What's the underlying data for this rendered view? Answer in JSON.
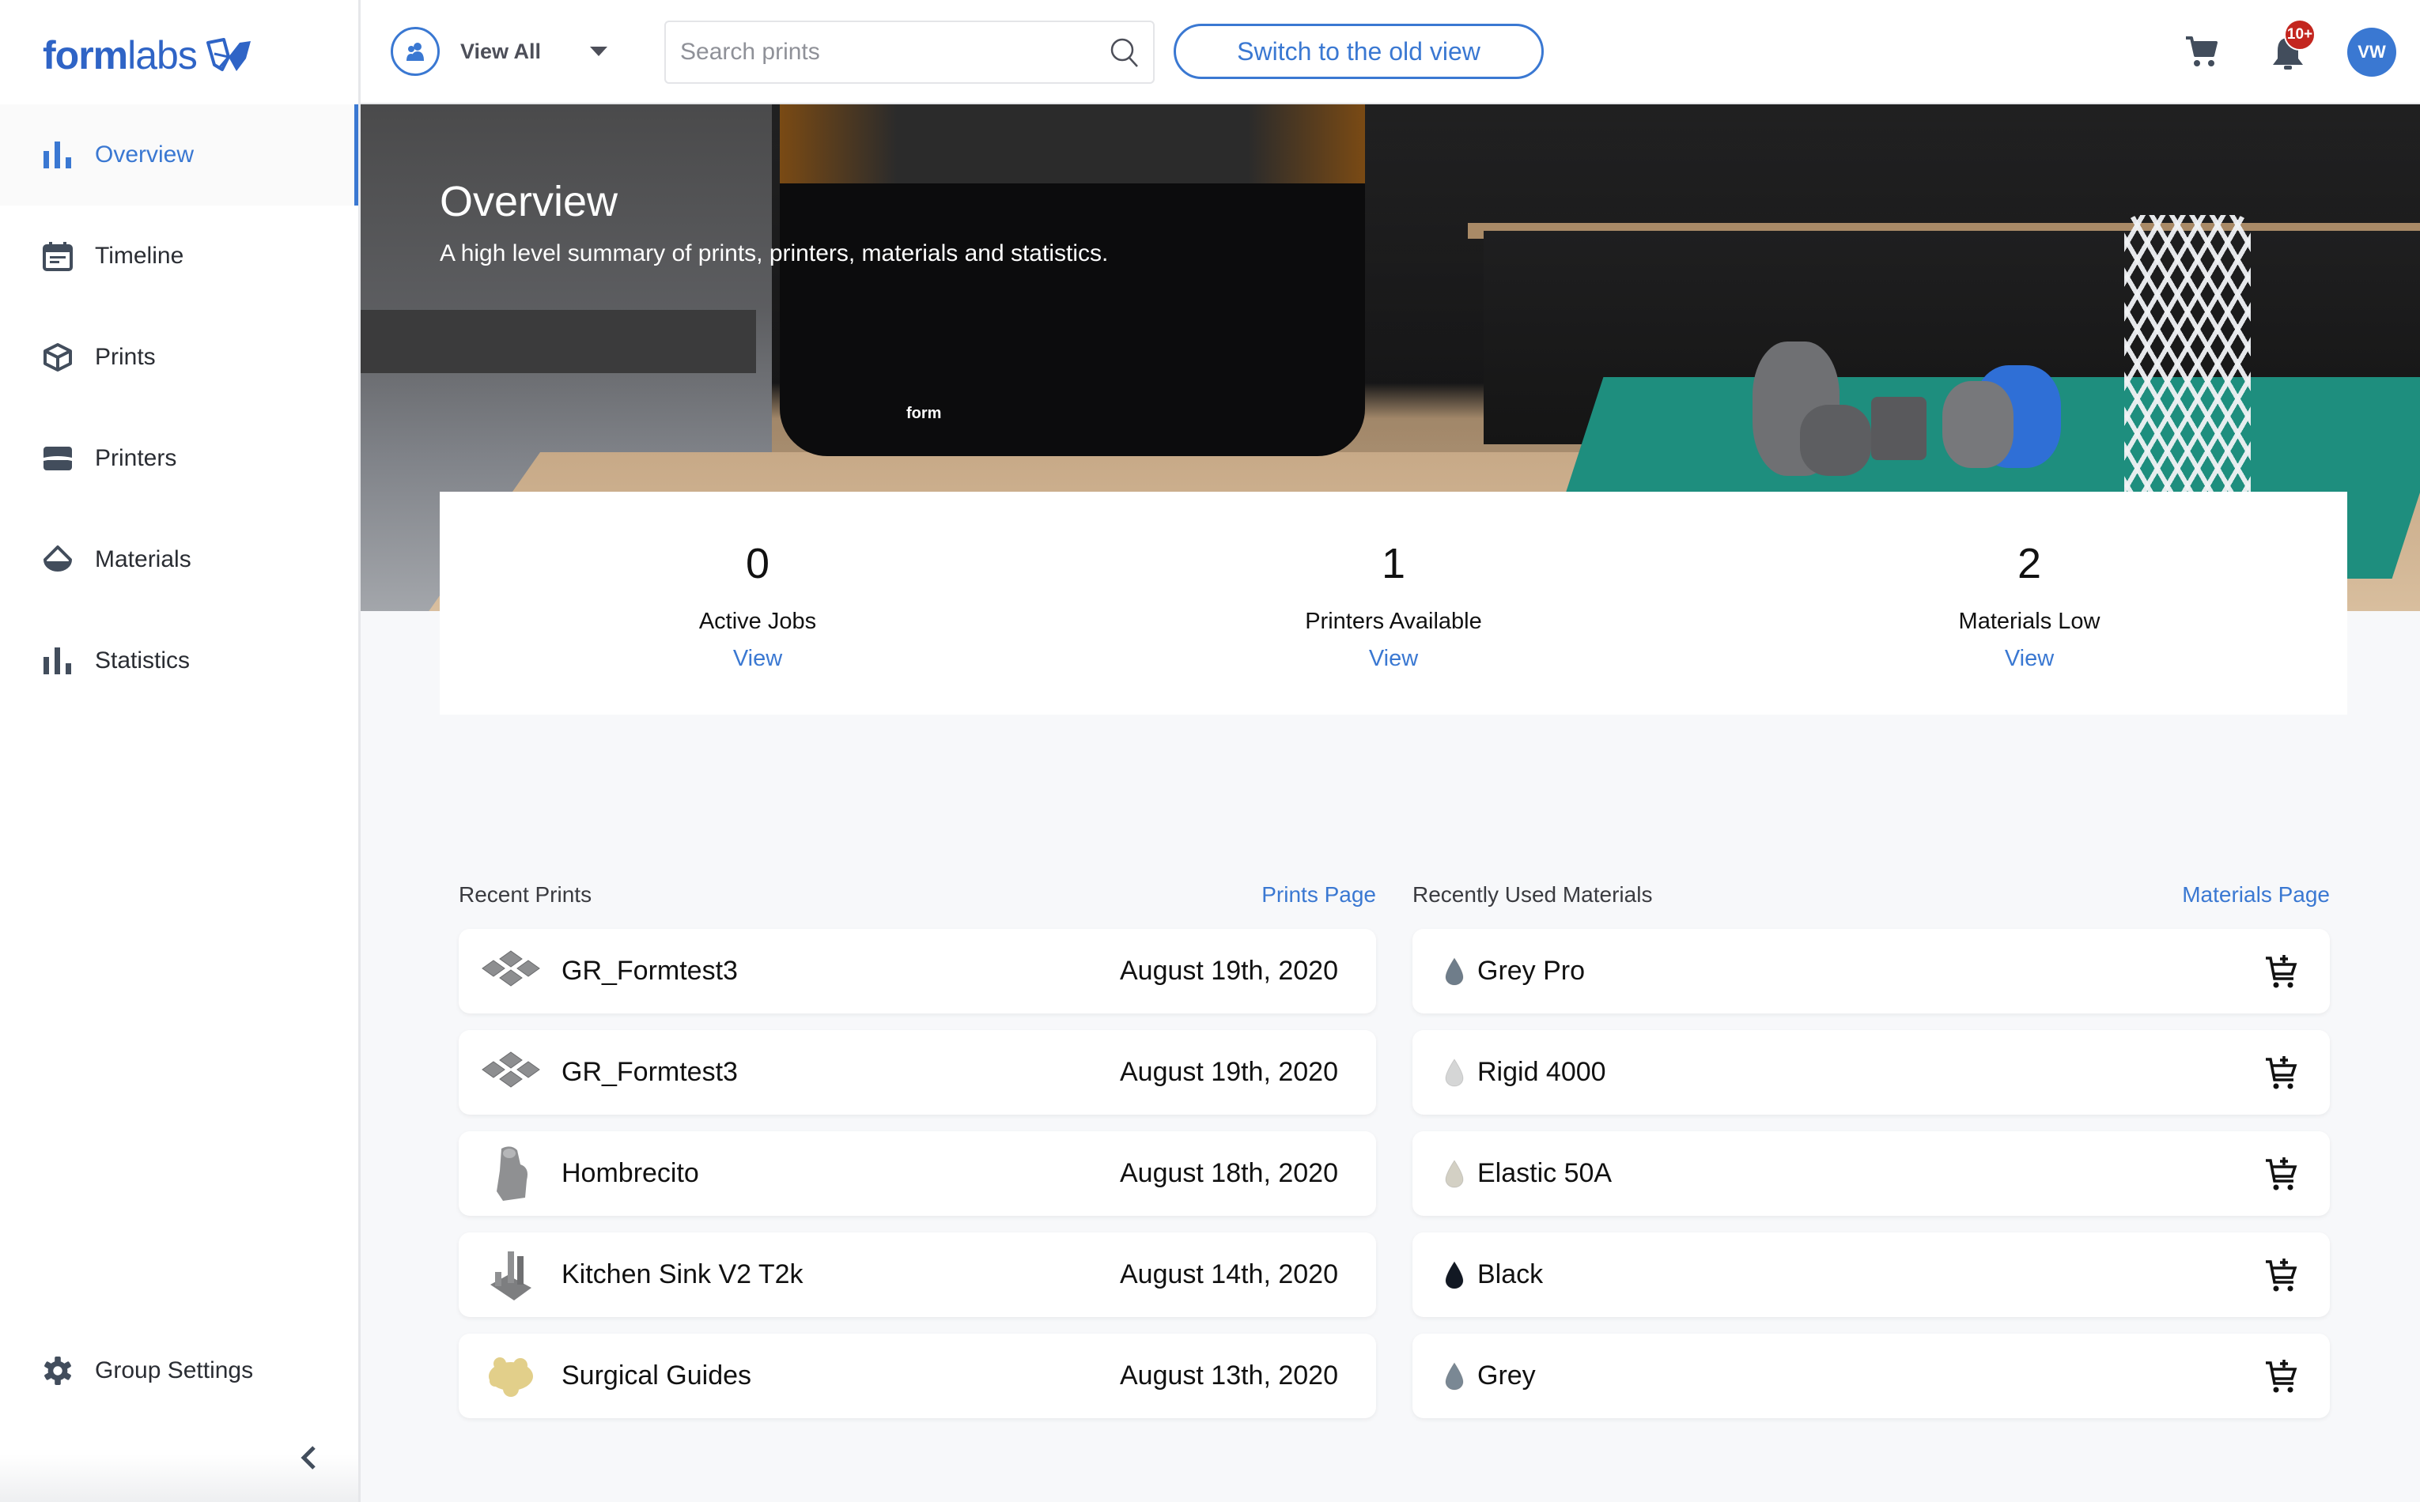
{
  "brand": {
    "logo_bold": "form",
    "logo_light": "labs",
    "accent": "#3a78d2"
  },
  "topbar": {
    "view_filter": "View All",
    "search_placeholder": "Search prints",
    "search_value": "",
    "old_view_button": "Switch to the old view",
    "notification_badge": "10+",
    "avatar_initials": "VW"
  },
  "sidebar": {
    "items": [
      {
        "label": "Overview",
        "icon": "bar-chart-icon",
        "active": true
      },
      {
        "label": "Timeline",
        "icon": "calendar-icon",
        "active": false
      },
      {
        "label": "Prints",
        "icon": "cube-icon",
        "active": false
      },
      {
        "label": "Printers",
        "icon": "printer-icon",
        "active": false
      },
      {
        "label": "Materials",
        "icon": "resin-drop-icon",
        "active": false
      },
      {
        "label": "Statistics",
        "icon": "bar-chart-icon",
        "active": false
      }
    ],
    "group_settings": "Group Settings"
  },
  "hero": {
    "title": "Overview",
    "subtitle": "A high level summary of prints, printers, materials and statistics."
  },
  "stats": [
    {
      "value": "0",
      "label": "Active Jobs",
      "link": "View"
    },
    {
      "value": "1",
      "label": "Printers Available",
      "link": "View"
    },
    {
      "value": "2",
      "label": "Materials Low",
      "link": "View"
    }
  ],
  "recent_prints": {
    "title": "Recent Prints",
    "link": "Prints Page",
    "items": [
      {
        "name": "GR_Formtest3",
        "date": "August 19th, 2020",
        "thumb": "tiles"
      },
      {
        "name": "GR_Formtest3",
        "date": "August 19th, 2020",
        "thumb": "tiles"
      },
      {
        "name": "Hombrecito",
        "date": "August 18th, 2020",
        "thumb": "figure"
      },
      {
        "name": "Kitchen Sink V2 T2k",
        "date": "August 14th, 2020",
        "thumb": "sink"
      },
      {
        "name": "Surgical Guides",
        "date": "August 13th, 2020",
        "thumb": "guides"
      }
    ]
  },
  "recent_materials": {
    "title": "Recently Used Materials",
    "link": "Materials Page",
    "items": [
      {
        "name": "Grey Pro",
        "color": "#6f7d8a"
      },
      {
        "name": "Rigid 4000",
        "color": "#d5d6d6"
      },
      {
        "name": "Elastic 50A",
        "color": "#d3d0c4"
      },
      {
        "name": "Black",
        "color": "#121823"
      },
      {
        "name": "Grey",
        "color": "#7a8894"
      }
    ]
  }
}
